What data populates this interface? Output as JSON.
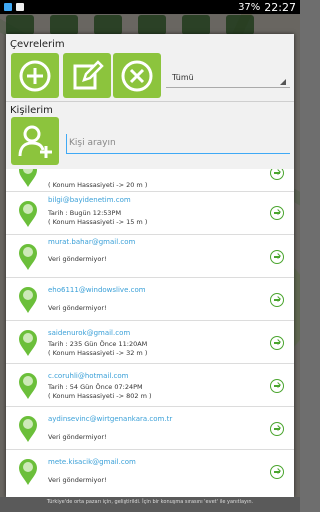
{
  "status_bar": {
    "battery": "37%",
    "time": "22:27"
  },
  "header": {
    "circles_title": "Çevrelerim",
    "filter_selected": "Tümü",
    "people_title": "Kişilerim",
    "search_placeholder": "Kişi arayın"
  },
  "contacts": [
    {
      "email": "",
      "lines": [
        "( Konum Hassasiyeti -> 20 m )"
      ]
    },
    {
      "email": "bilgi@bayidenetim.com",
      "lines": [
        "Tarih    : Bugün 12:53PM",
        "( Konum Hassasiyeti -> 15 m )"
      ]
    },
    {
      "email": "murat.bahar@gmail.com",
      "lines": [
        "Veri göndermiyor!"
      ]
    },
    {
      "email": "eho6111@windowslive.com",
      "lines": [
        "Veri göndermiyor!"
      ]
    },
    {
      "email": "saidenurok@gmail.com",
      "lines": [
        "Tarih    : 235 Gün Önce 11:20AM",
        "( Konum Hassasiyeti -> 32 m )"
      ]
    },
    {
      "email": "c.coruhli@hotmail.com",
      "lines": [
        "Tarih    : 54 Gün Önce 07:24PM",
        "( Konum Hassasiyeti -> 802 m )"
      ]
    },
    {
      "email": "aydinsevinc@wirtgenankara.com.tr",
      "lines": [
        "Veri göndermiyor!"
      ]
    },
    {
      "email": "mete.kisacik@gmail.com",
      "lines": [
        "Veri göndermiyor!"
      ]
    }
  ],
  "footer": {
    "text": "Türkiye'de orta pazarı için, geliştirildi. İçin bir konuşma sırasını 'evet' ile yanıtlayın."
  },
  "colors": {
    "accent_green": "#8cc43d",
    "link_blue": "#3aa0d8",
    "arrow_green": "#4aa52e"
  }
}
